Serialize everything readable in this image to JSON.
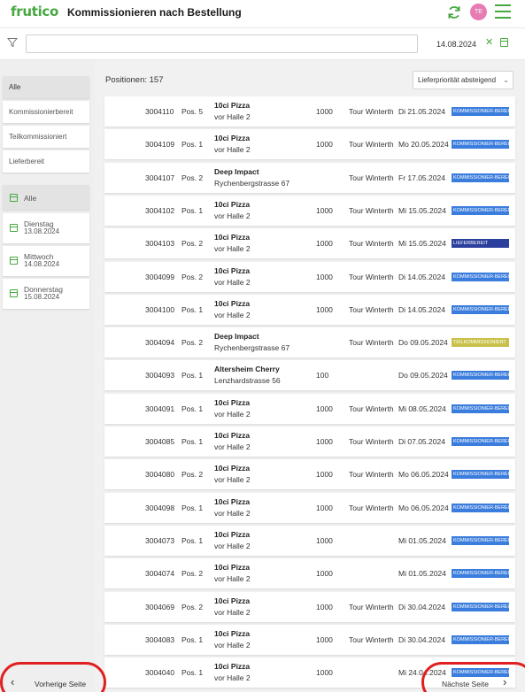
{
  "header": {
    "logo": "frutico",
    "title": "Kommissionieren nach Bestellung",
    "avatar_initials": "TE",
    "accent": "#46a83f"
  },
  "filter": {
    "search_value": "",
    "date": "14.08.2024",
    "clear_icon": "✕"
  },
  "sidebar": {
    "status_items": [
      {
        "label": "Alle",
        "active": true
      },
      {
        "label": "Kommissionierbereit",
        "active": false
      },
      {
        "label": "Teilkommissioniert",
        "active": false
      },
      {
        "label": "Lieferbereit",
        "active": false
      }
    ],
    "day_items": [
      {
        "label": "Alle",
        "date": "",
        "active": true
      },
      {
        "label": "Dienstag",
        "date": "13.08.2024",
        "active": false
      },
      {
        "label": "Mittwoch",
        "date": "14.08.2024",
        "active": false
      },
      {
        "label": "Donnerstag",
        "date": "15.08.2024",
        "active": false
      }
    ]
  },
  "main": {
    "count_label": "Positionen: 157",
    "sort_label": "Lieferpriorität absteigend",
    "rows": [
      {
        "order": "3004110",
        "pos": "Pos. 5",
        "name": "10ci Pizza",
        "sub": "vor Halle 2",
        "qty": "1000",
        "tour": "Tour Winterthur",
        "date": "Di 21.05.2024",
        "status": "KOMMISSIONIER-BEREIT",
        "status_color": "#3b7ddd"
      },
      {
        "order": "3004109",
        "pos": "Pos. 1",
        "name": "10ci Pizza",
        "sub": "vor Halle 2",
        "qty": "1000",
        "tour": "Tour Winterthur",
        "date": "Mo 20.05.2024",
        "status": "KOMMISSIONIER-BEREIT",
        "status_color": "#3b7ddd"
      },
      {
        "order": "3004107",
        "pos": "Pos. 2",
        "name": "Deep Impact",
        "sub": "Rychenbergstrasse 67",
        "qty": "",
        "tour": "Tour Winterthur",
        "date": "Fr 17.05.2024",
        "status": "KOMMISSIONIER-BEREIT",
        "status_color": "#3b7ddd"
      },
      {
        "order": "3004102",
        "pos": "Pos. 1",
        "name": "10ci Pizza",
        "sub": "vor Halle 2",
        "qty": "1000",
        "tour": "Tour Winterthur",
        "date": "Mi 15.05.2024",
        "status": "KOMMISSIONIER-BEREIT",
        "status_color": "#3b7ddd"
      },
      {
        "order": "3004103",
        "pos": "Pos. 2",
        "name": "10ci Pizza",
        "sub": "vor Halle 2",
        "qty": "1000",
        "tour": "Tour Winterthur",
        "date": "Mi 15.05.2024",
        "status": "LIEFERBEREIT",
        "status_color": "#2b3f9c"
      },
      {
        "order": "3004099",
        "pos": "Pos. 2",
        "name": "10ci Pizza",
        "sub": "vor Halle 2",
        "qty": "1000",
        "tour": "Tour Winterthur",
        "date": "Di 14.05.2024",
        "status": "KOMMISSIONIER-BEREIT",
        "status_color": "#3b7ddd"
      },
      {
        "order": "3004100",
        "pos": "Pos. 1",
        "name": "10ci Pizza",
        "sub": "vor Halle 2",
        "qty": "1000",
        "tour": "Tour Winterthur",
        "date": "Di 14.05.2024",
        "status": "KOMMISSIONIER-BEREIT",
        "status_color": "#3b7ddd"
      },
      {
        "order": "3004094",
        "pos": "Pos. 2",
        "name": "Deep Impact",
        "sub": "Rychenbergstrasse 67",
        "qty": "",
        "tour": "Tour Winterthur",
        "date": "Do 09.05.2024",
        "status": "TEILKOMMISSIONIERT",
        "status_color": "#c9c14a"
      },
      {
        "order": "3004093",
        "pos": "Pos. 1",
        "name": "Altersheim Cherry",
        "sub": "Lenzhardstrasse 56",
        "qty": "100",
        "tour": "",
        "date": "Do 09.05.2024",
        "status": "KOMMISSIONIER-BEREIT",
        "status_color": "#3b7ddd"
      },
      {
        "order": "3004091",
        "pos": "Pos. 1",
        "name": "10ci Pizza",
        "sub": "vor Halle 2",
        "qty": "1000",
        "tour": "Tour Winterthur",
        "date": "Mi 08.05.2024",
        "status": "KOMMISSIONIER-BEREIT",
        "status_color": "#3b7ddd"
      },
      {
        "order": "3004085",
        "pos": "Pos. 1",
        "name": "10ci Pizza",
        "sub": "vor Halle 2",
        "qty": "1000",
        "tour": "Tour Winterthur",
        "date": "Di 07.05.2024",
        "status": "KOMMISSIONIER-BEREIT",
        "status_color": "#3b7ddd"
      },
      {
        "order": "3004080",
        "pos": "Pos. 2",
        "name": "10ci Pizza",
        "sub": "vor Halle 2",
        "qty": "1000",
        "tour": "Tour Winterthur",
        "date": "Mo 06.05.2024",
        "status": "KOMMISSIONIER-BEREIT",
        "status_color": "#3b7ddd"
      },
      {
        "order": "3004098",
        "pos": "Pos. 1",
        "name": "10ci Pizza",
        "sub": "vor Halle 2",
        "qty": "1000",
        "tour": "Tour Winterthur",
        "date": "Mo 06.05.2024",
        "status": "KOMMISSIONIER-BEREIT",
        "status_color": "#3b7ddd"
      },
      {
        "order": "3004073",
        "pos": "Pos. 1",
        "name": "10ci Pizza",
        "sub": "vor Halle 2",
        "qty": "1000",
        "tour": "",
        "date": "Mi 01.05.2024",
        "status": "KOMMISSIONIER-BEREIT",
        "status_color": "#3b7ddd"
      },
      {
        "order": "3004074",
        "pos": "Pos. 2",
        "name": "10ci Pizza",
        "sub": "vor Halle 2",
        "qty": "1000",
        "tour": "",
        "date": "Mi 01.05.2024",
        "status": "KOMMISSIONIER-BEREIT",
        "status_color": "#3b7ddd"
      },
      {
        "order": "3004069",
        "pos": "Pos. 2",
        "name": "10ci Pizza",
        "sub": "vor Halle 2",
        "qty": "1000",
        "tour": "Tour Winterthur",
        "date": "Di 30.04.2024",
        "status": "KOMMISSIONIER-BEREIT",
        "status_color": "#3b7ddd"
      },
      {
        "order": "3004083",
        "pos": "Pos. 1",
        "name": "10ci Pizza",
        "sub": "vor Halle 2",
        "qty": "1000",
        "tour": "Tour Winterthur",
        "date": "Di 30.04.2024",
        "status": "KOMMISSIONIER-BEREIT",
        "status_color": "#3b7ddd"
      },
      {
        "order": "3004040",
        "pos": "Pos. 1",
        "name": "10ci Pizza",
        "sub": "vor Halle 2",
        "qty": "1000",
        "tour": "",
        "date": "Mi 24.04.2024",
        "status": "KOMMISSIONIER-BEREIT",
        "status_color": "#3b7ddd"
      }
    ]
  },
  "pagination": {
    "prev_label": "Vorherige Seite",
    "next_label": "Nächste Seite"
  }
}
